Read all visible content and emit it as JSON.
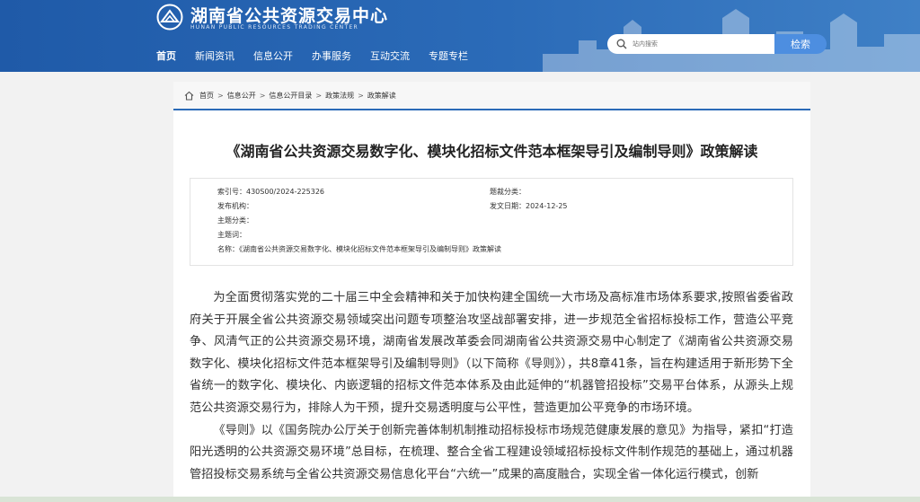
{
  "header": {
    "title_cn": "湖南省公共资源交易中心",
    "title_en": "HUNAN PUBLIC RESOURCES TRADING CENTER",
    "nav": [
      "首页",
      "新闻资讯",
      "信息公开",
      "办事服务",
      "互动交流",
      "专题专栏"
    ],
    "search_placeholder": "站内搜索",
    "search_button": "检索"
  },
  "breadcrumb": [
    "首页",
    "信息公开",
    "信息公开目录",
    "政策法规",
    "政策解读"
  ],
  "article": {
    "title": "《湖南省公共资源交易数字化、模块化招标文件范本框架导引及编制导则》政策解读",
    "meta": {
      "index_label": "索引号：",
      "index_value": "430S00/2024-225326",
      "category_label": "题裁分类：",
      "category_value": "",
      "publisher_label": "发布机构：",
      "publisher_value": "",
      "date_label": "发文日期：",
      "date_value": "2024-12-25",
      "topic_label": "主题分类：",
      "topic_value": "",
      "keyword_label": "主题词：",
      "keyword_value": "",
      "name_label": "名称：",
      "name_value": "《湖南省公共资源交易数字化、模块化招标文件范本框架导引及编制导则》政策解读"
    },
    "paragraphs": [
      "为全面贯彻落实党的二十届三中全会精神和关于加快构建全国统一大市场及高标准市场体系要求,按照省委省政府关于开展全省公共资源交易领域突出问题专项整治攻坚战部署安排，进一步规范全省招标投标工作，营造公平竞争、风清气正的公共资源交易环境，湖南省发展改革委会同湖南省公共资源交易中心制定了《湖南省公共资源交易数字化、模块化招标文件范本框架导引及编制导则》（以下简称《导则》），共8章41条，旨在构建适用于新形势下全省统一的数字化、模块化、内嵌逻辑的招标文件范本体系及由此延伸的“机器管招投标”交易平台体系，从源头上规范公共资源交易行为，排除人为干预，提升交易透明度与公平性，营造更加公平竞争的市场环境。",
      "《导则》以《国务院办公厅关于创新完善体制机制推动招标投标市场规范健康发展的意见》为指导，紧扣“打造阳光透明的公共资源交易环境”总目标，在梳理、整合全省工程建设领域招标投标文件制作规范的基础上，通过机器管招投标交易系统与全省公共资源交易信息化平台“六统一”成果的高度融合，实现全省一体化运行模式，创新"
    ]
  }
}
